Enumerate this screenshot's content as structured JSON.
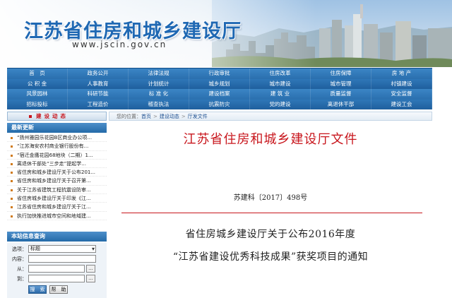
{
  "banner": {
    "site_title": "江苏省住房和城乡建设厅",
    "url": "www.jscin.gov.cn"
  },
  "nav": {
    "rows": [
      [
        "首　页",
        "政务公开",
        "法律法规",
        "行政审批",
        "住房改革",
        "住房保障",
        "房 地 产"
      ],
      [
        "公 积 金",
        "人事教育",
        "计划统计",
        "城乡规划",
        "城市建设",
        "城市管理",
        "村镇建设"
      ],
      [
        "风景园林",
        "科研节能",
        "标 准 化",
        "建设档案",
        "建 筑 业",
        "质量监督",
        "安全监督"
      ],
      [
        "招标投标",
        "工程造价",
        "稽查执法",
        "抗震防灾",
        "党的建设",
        "离退休干部",
        "建设工会"
      ]
    ]
  },
  "sidebar": {
    "tab_label": "建设动态",
    "news_head": "最新更新",
    "news": [
      "“扬州雅园乐花园B区商业办公项...",
      "“江苏海安农村商业银行股份有...",
      "“宿迁金鹰花园68地块（二期）1...",
      "离退休干部处“三步走”提起学...",
      "省住房和城乡建设厅关于公布201...",
      "省住房和城乡建设厅关于召开第...",
      "关于江苏省建筑工程抗震设防审...",
      "省住房城乡建设厅关于印发《江...",
      "江苏省住房和城乡建设厅关于江...",
      "执行加快推进城市空间和地域建..."
    ],
    "search_head": "本站信息查询",
    "search": {
      "option_label": "选项：",
      "option_value": "标题",
      "content_label": "内容：",
      "from_label": "从：",
      "to_label": "到：",
      "dots": "...",
      "search_btn": "搜　索",
      "help_btn": "帮　助"
    }
  },
  "breadcrumb": {
    "prefix": "您的位置：",
    "items": [
      "首页",
      "建设动态",
      "厅发文件"
    ],
    "sep": ">"
  },
  "document": {
    "title": "江苏省住房和城乡建设厅文件",
    "number": "苏建科〔2017〕498号",
    "heading_line1": "省住房城乡建设厅关于公布2016年度",
    "heading_line2": "“江苏省建设优秀科技成果”获奖项目的通知"
  },
  "colors": {
    "nav_blue": "#2a6fae",
    "title_blue": "#1f68b3",
    "doc_red": "#c8161d"
  }
}
